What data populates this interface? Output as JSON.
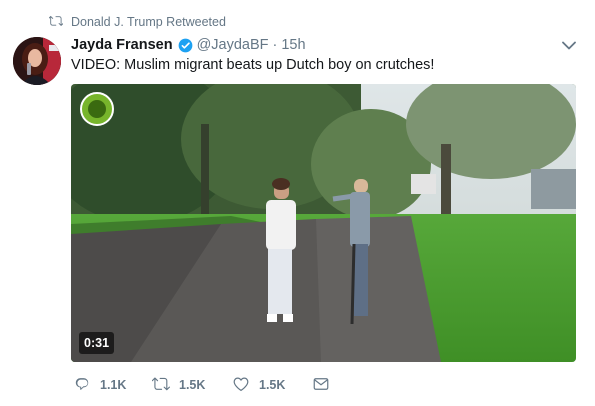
{
  "retweet_context": {
    "text": "Donald J. Trump Retweeted"
  },
  "author": {
    "name": "Jayda Fransen",
    "handle": "@JaydaBF",
    "separator": "·",
    "time": "15h"
  },
  "tweet": {
    "text": "VIDEO: Muslim migrant beats up Dutch boy on crutches!"
  },
  "media": {
    "duration": "0:31"
  },
  "actions": {
    "reply_count": "1.1K",
    "retweet_count": "1.5K",
    "like_count": "1.5K"
  },
  "colors": {
    "muted": "#657786",
    "verified": "#1da1f2",
    "text": "#14171a"
  }
}
